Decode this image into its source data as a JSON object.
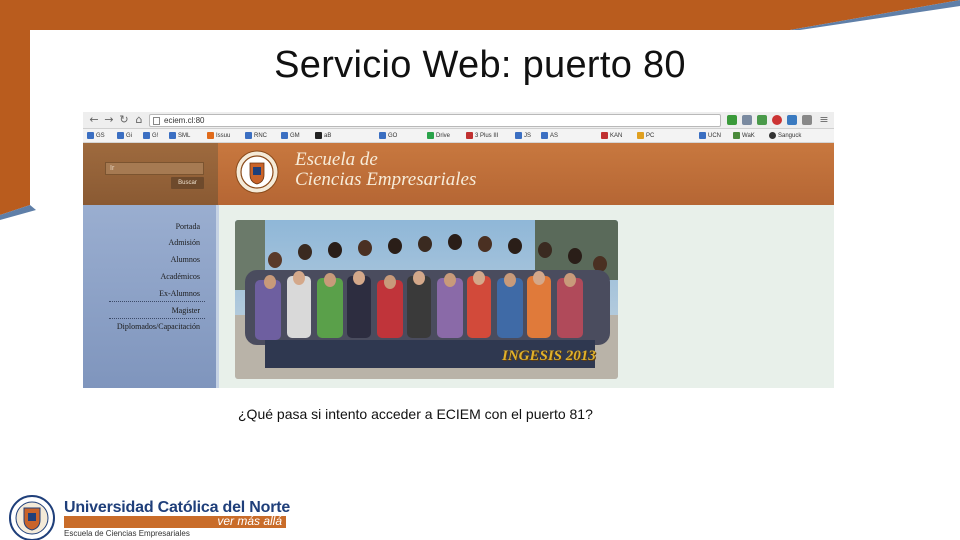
{
  "slide": {
    "title": "Servicio Web: puerto 80",
    "question": "¿Qué pasa si intento acceder a ECIEM con el puerto 81?"
  },
  "browser": {
    "address": "eciem.cl:80",
    "bookmarks": [
      "GS",
      "Gi",
      "G!",
      "SML",
      "Issuu",
      "RNC",
      "GM",
      "aB",
      "GO",
      "Drive",
      "3 Plus III",
      "JS",
      "AS",
      "KAN",
      "PC",
      "UCN",
      "WaK",
      "Sanguck"
    ]
  },
  "site": {
    "name_line1": "Escuela de",
    "name_line2": "Ciencias Empresariales",
    "search_placeholder": "Ir",
    "search_button": "Buscar",
    "menu": [
      "Portada",
      "Admisión",
      "Alumnos",
      "Académicos",
      "Ex-Alumnos",
      "Magister",
      "Diplomados/Capacitación"
    ],
    "photo_caption": "INGESIS 2013"
  },
  "footer": {
    "university": "Universidad Católica del Norte",
    "motto": "ver más allá",
    "school": "Escuela de Ciencias Empresariales"
  },
  "colors": {
    "accent_orange": "#c0601f",
    "accent_blue": "#4a6a9a",
    "site_header": "#b56634",
    "sidebar": "#8ea3c8"
  }
}
